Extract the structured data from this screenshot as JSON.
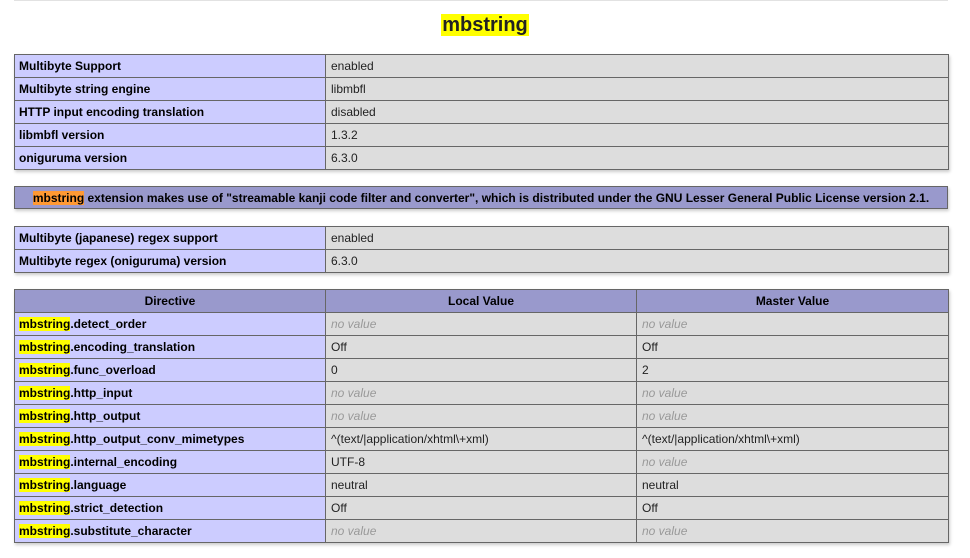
{
  "title": "mbstring",
  "info_rows": [
    {
      "label": "Multibyte Support",
      "value": "enabled"
    },
    {
      "label": "Multibyte string engine",
      "value": "libmbfl"
    },
    {
      "label": "HTTP input encoding translation",
      "value": "disabled"
    },
    {
      "label": "libmbfl version",
      "value": "1.3.2"
    },
    {
      "label": "oniguruma version",
      "value": "6.3.0"
    }
  ],
  "notice": {
    "highlight": "mbstring",
    "text": " extension makes use of \"streamable kanji code filter and converter\", which is distributed under the GNU Lesser General Public License version 2.1."
  },
  "regex_rows": [
    {
      "label": "Multibyte (japanese) regex support",
      "value": "enabled"
    },
    {
      "label": "Multibyte regex (oniguruma) version",
      "value": "6.3.0"
    }
  ],
  "directives": {
    "headers": [
      "Directive",
      "Local Value",
      "Master Value"
    ],
    "prefix": "mbstring",
    "rows": [
      {
        "name": ".detect_order",
        "local": "no value",
        "master": "no value"
      },
      {
        "name": ".encoding_translation",
        "local": "Off",
        "master": "Off"
      },
      {
        "name": ".func_overload",
        "local": "0",
        "master": "2"
      },
      {
        "name": ".http_input",
        "local": "no value",
        "master": "no value"
      },
      {
        "name": ".http_output",
        "local": "no value",
        "master": "no value"
      },
      {
        "name": ".http_output_conv_mimetypes",
        "local": "^(text/|application/xhtml\\+xml)",
        "master": "^(text/|application/xhtml\\+xml)"
      },
      {
        "name": ".internal_encoding",
        "local": "UTF-8",
        "master": "no value"
      },
      {
        "name": ".language",
        "local": "neutral",
        "master": "neutral"
      },
      {
        "name": ".strict_detection",
        "local": "Off",
        "master": "Off"
      },
      {
        "name": ".substitute_character",
        "local": "no value",
        "master": "no value"
      }
    ]
  },
  "colors": {
    "header_bg": "#9999cc",
    "label_bg": "#ccccff",
    "value_bg": "#dddddd",
    "highlight": "#ffff00",
    "highlight_orange": "#ff9933"
  }
}
